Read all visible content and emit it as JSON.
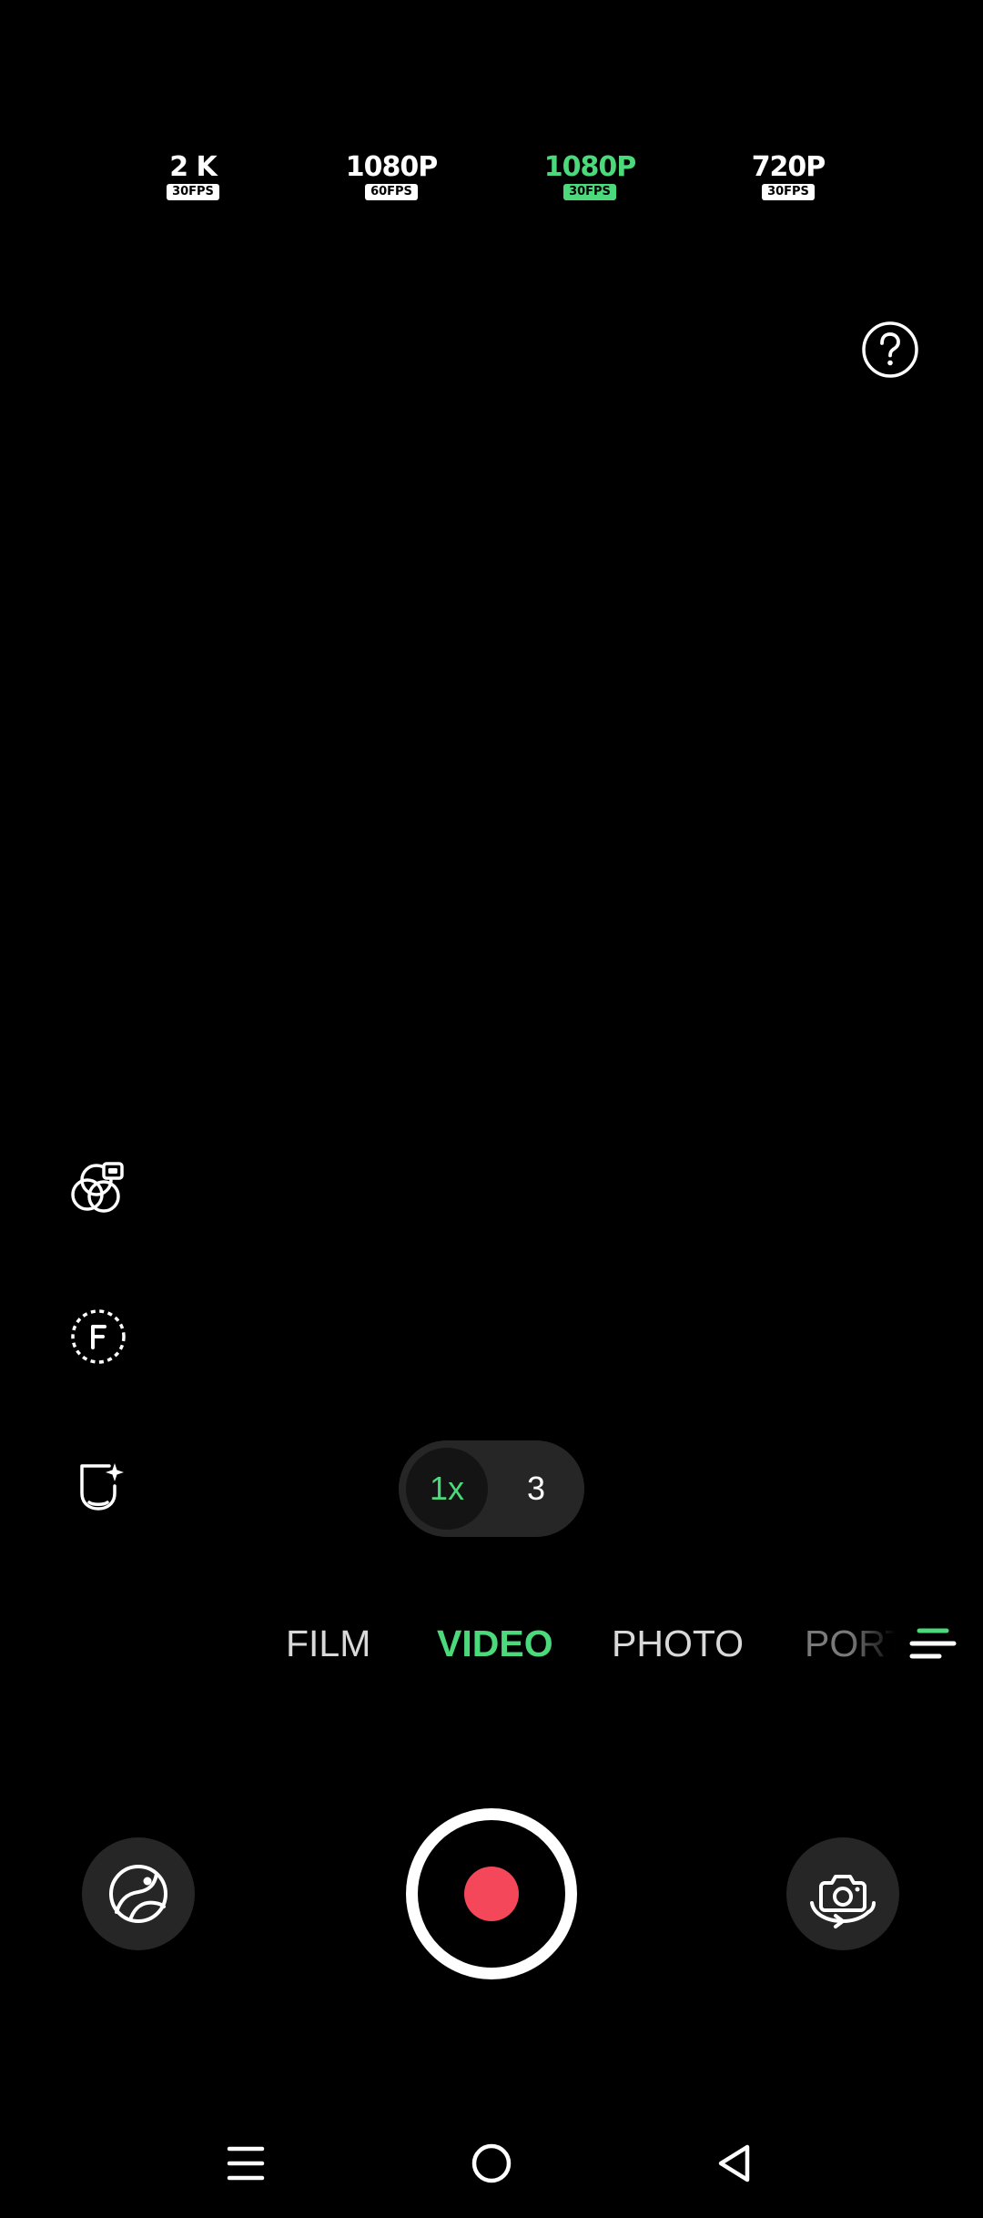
{
  "resolution_options": [
    {
      "label": "2 K",
      "fps": "30FPS",
      "selected": false
    },
    {
      "label": "1080P",
      "fps": "60FPS",
      "selected": false
    },
    {
      "label": "1080P",
      "fps": "30FPS",
      "selected": true
    },
    {
      "label": "720P",
      "fps": "30FPS",
      "selected": false
    }
  ],
  "help_button": {
    "label": "?",
    "icon": "help-icon"
  },
  "side_tools": [
    {
      "icon": "filter-icon"
    },
    {
      "icon": "flash-icon",
      "label": "F"
    },
    {
      "icon": "beauty-face-icon"
    }
  ],
  "zoom": {
    "options": [
      "1x",
      "3"
    ],
    "selected": "1x"
  },
  "modes": {
    "items": [
      "FILM",
      "VIDEO",
      "PHOTO",
      "PORTRAIT"
    ],
    "selected": "VIDEO",
    "more_icon": "menu-lines-icon"
  },
  "controls": {
    "gallery_icon": "gallery-icon",
    "record_icon": "record-icon",
    "flip_camera_icon": "flip-camera-icon"
  },
  "nav_bar": {
    "icons": [
      "recent-apps-icon",
      "home-icon",
      "back-icon"
    ]
  },
  "colors": {
    "accent": "#4cd97b",
    "record": "#f5475a",
    "background": "#000000",
    "control_bg": "#262626"
  }
}
